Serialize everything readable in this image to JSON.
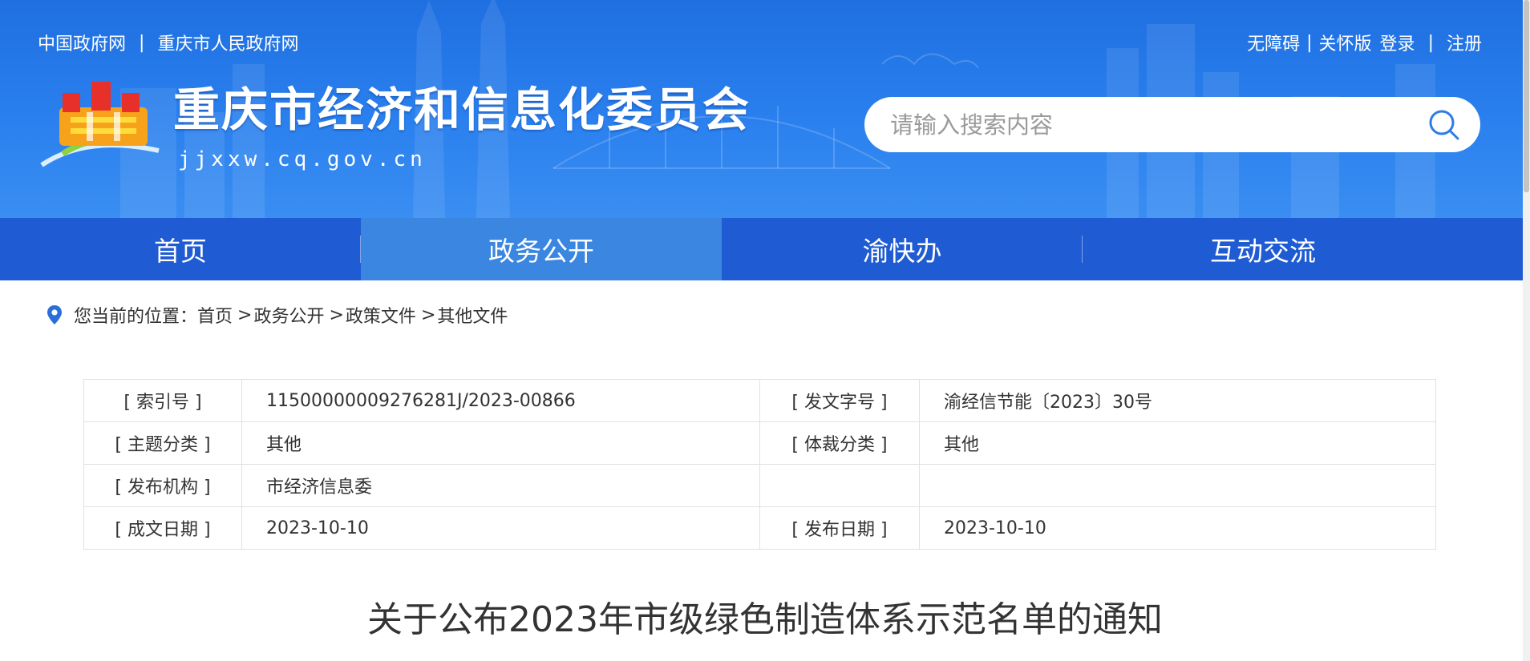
{
  "header": {
    "top_links_left": [
      "中国政府网",
      "重庆市人民政府网"
    ],
    "top_links_right": {
      "accessibility": "无障碍",
      "care_version": "关怀版",
      "login": "登录",
      "register": "注册"
    },
    "site_title": "重庆市经济和信息化委员会",
    "site_domain": "jjxxw.cq.gov.cn",
    "search": {
      "placeholder": "请输入搜索内容",
      "value": "",
      "icon": "search-icon"
    },
    "logo_icon": "chongqing-emblem-logo",
    "colors": {
      "banner_blue": "#2a80ee",
      "nav_blue": "#1f5bd3",
      "nav_active": "#3a86e0"
    }
  },
  "nav": {
    "items": [
      {
        "label": "首页",
        "active": false
      },
      {
        "label": "政务公开",
        "active": true
      },
      {
        "label": "渝快办",
        "active": false
      },
      {
        "label": "互动交流",
        "active": false
      }
    ]
  },
  "breadcrumb": {
    "icon": "location-pin-icon",
    "prefix": "您当前的位置：",
    "items": [
      "首页",
      "政务公开",
      "政策文件",
      "其他文件"
    ],
    "separator": ">"
  },
  "meta": {
    "rows": [
      {
        "label1": "[ 索引号 ]",
        "value1": "11500000009276281J/2023-00866",
        "label2": "[ 发文字号 ]",
        "value2": "渝经信节能〔2023〕30号"
      },
      {
        "label1": "[ 主题分类 ]",
        "value1": "其他",
        "label2": "[ 体裁分类 ]",
        "value2": "其他"
      },
      {
        "label1": "[ 发布机构 ]",
        "value1": "市经济信息委",
        "label2": "",
        "value2": ""
      },
      {
        "label1": "[ 成文日期 ]",
        "value1": "2023-10-10",
        "label2": "[ 发布日期 ]",
        "value2": "2023-10-10"
      }
    ]
  },
  "article": {
    "title": "关于公布2023年市级绿色制造体系示范名单的通知"
  }
}
